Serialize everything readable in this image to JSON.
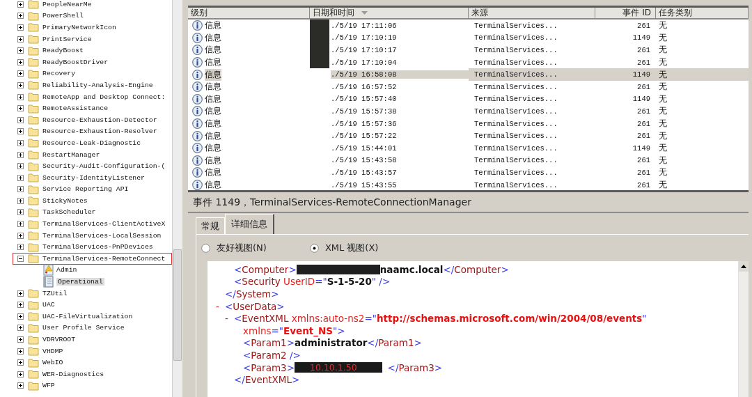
{
  "tree": {
    "items": [
      {
        "label": "PeopleNearMe",
        "kind": "folder",
        "expanded": false,
        "highlighted": false
      },
      {
        "label": "PowerShell",
        "kind": "folder",
        "expanded": false,
        "highlighted": false
      },
      {
        "label": "PrimaryNetworkIcon",
        "kind": "folder",
        "expanded": false,
        "highlighted": false
      },
      {
        "label": "PrintService",
        "kind": "folder",
        "expanded": false,
        "highlighted": false
      },
      {
        "label": "ReadyBoost",
        "kind": "folder",
        "expanded": false,
        "highlighted": false
      },
      {
        "label": "ReadyBoostDriver",
        "kind": "folder",
        "expanded": false,
        "highlighted": false
      },
      {
        "label": "Recovery",
        "kind": "folder",
        "expanded": false,
        "highlighted": false
      },
      {
        "label": "Reliability-Analysis-Engine",
        "kind": "folder",
        "expanded": false,
        "highlighted": false
      },
      {
        "label": "RemoteApp and Desktop Connect:",
        "kind": "folder",
        "expanded": false,
        "highlighted": false
      },
      {
        "label": "RemoteAssistance",
        "kind": "folder",
        "expanded": false,
        "highlighted": false
      },
      {
        "label": "Resource-Exhaustion-Detector",
        "kind": "folder",
        "expanded": false,
        "highlighted": false
      },
      {
        "label": "Resource-Exhaustion-Resolver",
        "kind": "folder",
        "expanded": false,
        "highlighted": false
      },
      {
        "label": "Resource-Leak-Diagnostic",
        "kind": "folder",
        "expanded": false,
        "highlighted": false
      },
      {
        "label": "RestartManager",
        "kind": "folder",
        "expanded": false,
        "highlighted": false
      },
      {
        "label": "Security-Audit-Configuration-(",
        "kind": "folder",
        "expanded": false,
        "highlighted": false
      },
      {
        "label": "Security-IdentityListener",
        "kind": "folder",
        "expanded": false,
        "highlighted": false
      },
      {
        "label": "Service Reporting API",
        "kind": "folder",
        "expanded": false,
        "highlighted": false
      },
      {
        "label": "StickyNotes",
        "kind": "folder",
        "expanded": false,
        "highlighted": false
      },
      {
        "label": "TaskScheduler",
        "kind": "folder",
        "expanded": false,
        "highlighted": false
      },
      {
        "label": "TerminalServices-ClientActiveX",
        "kind": "folder",
        "expanded": false,
        "highlighted": false
      },
      {
        "label": "TerminalServices-LocalSession",
        "kind": "folder",
        "expanded": false,
        "highlighted": false
      },
      {
        "label": "TerminalServices-PnPDevices",
        "kind": "folder",
        "expanded": false,
        "highlighted": false
      },
      {
        "label": "TerminalServices-RemoteConnect",
        "kind": "folder",
        "expanded": true,
        "highlighted": true,
        "children": [
          {
            "label": "Admin",
            "kind": "admin-log",
            "selected": false
          },
          {
            "label": "Operational",
            "kind": "log",
            "selected": true
          }
        ]
      },
      {
        "label": "TZUtil",
        "kind": "folder",
        "expanded": false,
        "highlighted": false
      },
      {
        "label": "UAC",
        "kind": "folder",
        "expanded": false,
        "highlighted": false
      },
      {
        "label": "UAC-FileVirtualization",
        "kind": "folder",
        "expanded": false,
        "highlighted": false
      },
      {
        "label": "User Profile Service",
        "kind": "folder",
        "expanded": false,
        "highlighted": false
      },
      {
        "label": "VDRVROOT",
        "kind": "folder",
        "expanded": false,
        "highlighted": false
      },
      {
        "label": "VHDMP",
        "kind": "folder",
        "expanded": false,
        "highlighted": false
      },
      {
        "label": "WebIO",
        "kind": "folder",
        "expanded": false,
        "highlighted": false
      },
      {
        "label": "WER-Diagnostics",
        "kind": "folder",
        "expanded": false,
        "highlighted": false
      },
      {
        "label": "WFP",
        "kind": "folder",
        "expanded": false,
        "highlighted": false
      }
    ]
  },
  "table": {
    "columns": [
      {
        "label": "级别",
        "sorted": false
      },
      {
        "label": "日期和时间",
        "sorted": true
      },
      {
        "label": "来源",
        "sorted": false
      },
      {
        "label": "事件 ID",
        "sorted": false
      },
      {
        "label": "任务类别",
        "sorted": false
      }
    ],
    "rows": [
      {
        "level": "信息",
        "date": "./5/19 17:11:06",
        "source": "TerminalServices...",
        "event_id": "261",
        "task": "无",
        "selected": false,
        "redacted": true
      },
      {
        "level": "信息",
        "date": "./5/19 17:10:19",
        "source": "TerminalServices...",
        "event_id": "1149",
        "task": "无",
        "selected": false,
        "redacted": true
      },
      {
        "level": "信息",
        "date": "./5/19 17:10:17",
        "source": "TerminalServices...",
        "event_id": "261",
        "task": "无",
        "selected": false,
        "redacted": true
      },
      {
        "level": "信息",
        "date": "./5/19 17:10:04",
        "source": "TerminalServices...",
        "event_id": "261",
        "task": "无",
        "selected": false,
        "redacted": true
      },
      {
        "level": "信息",
        "date": "./5/19 16:58:08",
        "source": "TerminalServices...",
        "event_id": "1149",
        "task": "无",
        "selected": true,
        "redacted": false
      },
      {
        "level": "信息",
        "date": "./5/19 16:57:52",
        "source": "TerminalServices...",
        "event_id": "261",
        "task": "无",
        "selected": false,
        "redacted": false
      },
      {
        "level": "信息",
        "date": "./5/19 15:57:40",
        "source": "TerminalServices...",
        "event_id": "1149",
        "task": "无",
        "selected": false,
        "redacted": false
      },
      {
        "level": "信息",
        "date": "./5/19 15:57:38",
        "source": "TerminalServices...",
        "event_id": "261",
        "task": "无",
        "selected": false,
        "redacted": false
      },
      {
        "level": "信息",
        "date": "./5/19 15:57:36",
        "source": "TerminalServices...",
        "event_id": "261",
        "task": "无",
        "selected": false,
        "redacted": false
      },
      {
        "level": "信息",
        "date": "./5/19 15:57:22",
        "source": "TerminalServices...",
        "event_id": "261",
        "task": "无",
        "selected": false,
        "redacted": false
      },
      {
        "level": "信息",
        "date": "./5/19 15:44:01",
        "source": "TerminalServices...",
        "event_id": "1149",
        "task": "无",
        "selected": false,
        "redacted": false
      },
      {
        "level": "信息",
        "date": "./5/19 15:43:58",
        "source": "TerminalServices...",
        "event_id": "261",
        "task": "无",
        "selected": false,
        "redacted": false
      },
      {
        "level": "信息",
        "date": "./5/19 15:43:57",
        "source": "TerminalServices...",
        "event_id": "261",
        "task": "无",
        "selected": false,
        "redacted": false
      },
      {
        "level": "信息",
        "date": "./5/19 15:43:55",
        "source": "TerminalServices...",
        "event_id": "261",
        "task": "无",
        "selected": false,
        "redacted": false
      }
    ]
  },
  "detail": {
    "title": "事件 1149，TerminalServices-RemoteConnectionManager",
    "tabs": [
      {
        "label": "常规",
        "selected": false
      },
      {
        "label": "详细信息",
        "selected": true
      }
    ],
    "views": [
      {
        "label": "友好视图(N)",
        "selected": false
      },
      {
        "label": "XML 视图(X)",
        "selected": true
      }
    ],
    "xml": [
      {
        "children": [
          {
            "children": [
              {
                "segments": [
                  {
                    "kind": "punct",
                    "text": "<"
                  },
                  {
                    "kind": "name",
                    "text": "Computer"
                  },
                  {
                    "kind": "punct",
                    "text": ">"
                  },
                  {
                    "kind": "text",
                    "text": "naamc.local",
                    "redacted_before": true
                  },
                  {
                    "kind": "punct",
                    "text": "</"
                  },
                  {
                    "kind": "name",
                    "text": "Computer"
                  },
                  {
                    "kind": "punct",
                    "text": ">"
                  }
                ]
              },
              {
                "segments": [
                  {
                    "kind": "punct",
                    "text": "<"
                  },
                  {
                    "kind": "name",
                    "text": "Security "
                  },
                  {
                    "kind": "attr",
                    "text": "UserID"
                  },
                  {
                    "kind": "punct",
                    "text": "=\""
                  },
                  {
                    "kind": "value",
                    "text": "S-1-5-20"
                  },
                  {
                    "kind": "punct",
                    "text": "\" />"
                  }
                ]
              }
            ]
          },
          {
            "segments": [
              {
                "kind": "punct",
                "text": "</"
              },
              {
                "kind": "name",
                "text": "System"
              },
              {
                "kind": "punct",
                "text": ">"
              }
            ]
          },
          {
            "toggle": "-",
            "segments": [
              {
                "kind": "punct",
                "text": "<"
              },
              {
                "kind": "name",
                "text": "UserData"
              },
              {
                "kind": "punct",
                "text": ">"
              }
            ],
            "children": [
              {
                "toggle": "-",
                "segments": [
                  {
                    "kind": "punct",
                    "text": "<"
                  },
                  {
                    "kind": "name",
                    "text": "EventXML "
                  },
                  {
                    "kind": "attr",
                    "text": "xmlns:auto-ns2"
                  },
                  {
                    "kind": "punct",
                    "text": "=\""
                  },
                  {
                    "kind": "string",
                    "text": "http://schemas.microsoft.com/win/2004/08/events"
                  },
                  {
                    "kind": "punct",
                    "text": "\""
                  }
                ],
                "children": [
                  {
                    "segments": [
                      {
                        "kind": "attr",
                        "text": "xmlns"
                      },
                      {
                        "kind": "punct",
                        "text": "=\""
                      },
                      {
                        "kind": "string",
                        "text": "Event_NS"
                      },
                      {
                        "kind": "punct",
                        "text": "\">"
                      }
                    ]
                  },
                  {
                    "segments": [
                      {
                        "kind": "punct",
                        "text": "<"
                      },
                      {
                        "kind": "name",
                        "text": "Param1"
                      },
                      {
                        "kind": "punct",
                        "text": ">"
                      },
                      {
                        "kind": "text",
                        "text": "administrator"
                      },
                      {
                        "kind": "punct",
                        "text": "</"
                      },
                      {
                        "kind": "name",
                        "text": "Param1"
                      },
                      {
                        "kind": "punct",
                        "text": ">"
                      }
                    ]
                  },
                  {
                    "segments": [
                      {
                        "kind": "punct",
                        "text": "<"
                      },
                      {
                        "kind": "name",
                        "text": "Param2"
                      },
                      {
                        "kind": "punct",
                        "text": " />"
                      }
                    ]
                  },
                  {
                    "segments": [
                      {
                        "kind": "punct",
                        "text": "<"
                      },
                      {
                        "kind": "name",
                        "text": "Param3"
                      },
                      {
                        "kind": "punct",
                        "text": ">"
                      },
                      {
                        "kind": "redacted",
                        "text": "10.10.1.50"
                      },
                      {
                        "kind": "punct",
                        "text": "</"
                      },
                      {
                        "kind": "name",
                        "text": "Param3"
                      },
                      {
                        "kind": "punct",
                        "text": ">"
                      }
                    ]
                  }
                ]
              },
              {
                "segments": [
                  {
                    "kind": "punct",
                    "text": "</"
                  },
                  {
                    "kind": "name",
                    "text": "EventXML"
                  },
                  {
                    "kind": "punct",
                    "text": ">"
                  }
                ]
              }
            ]
          }
        ]
      }
    ]
  }
}
